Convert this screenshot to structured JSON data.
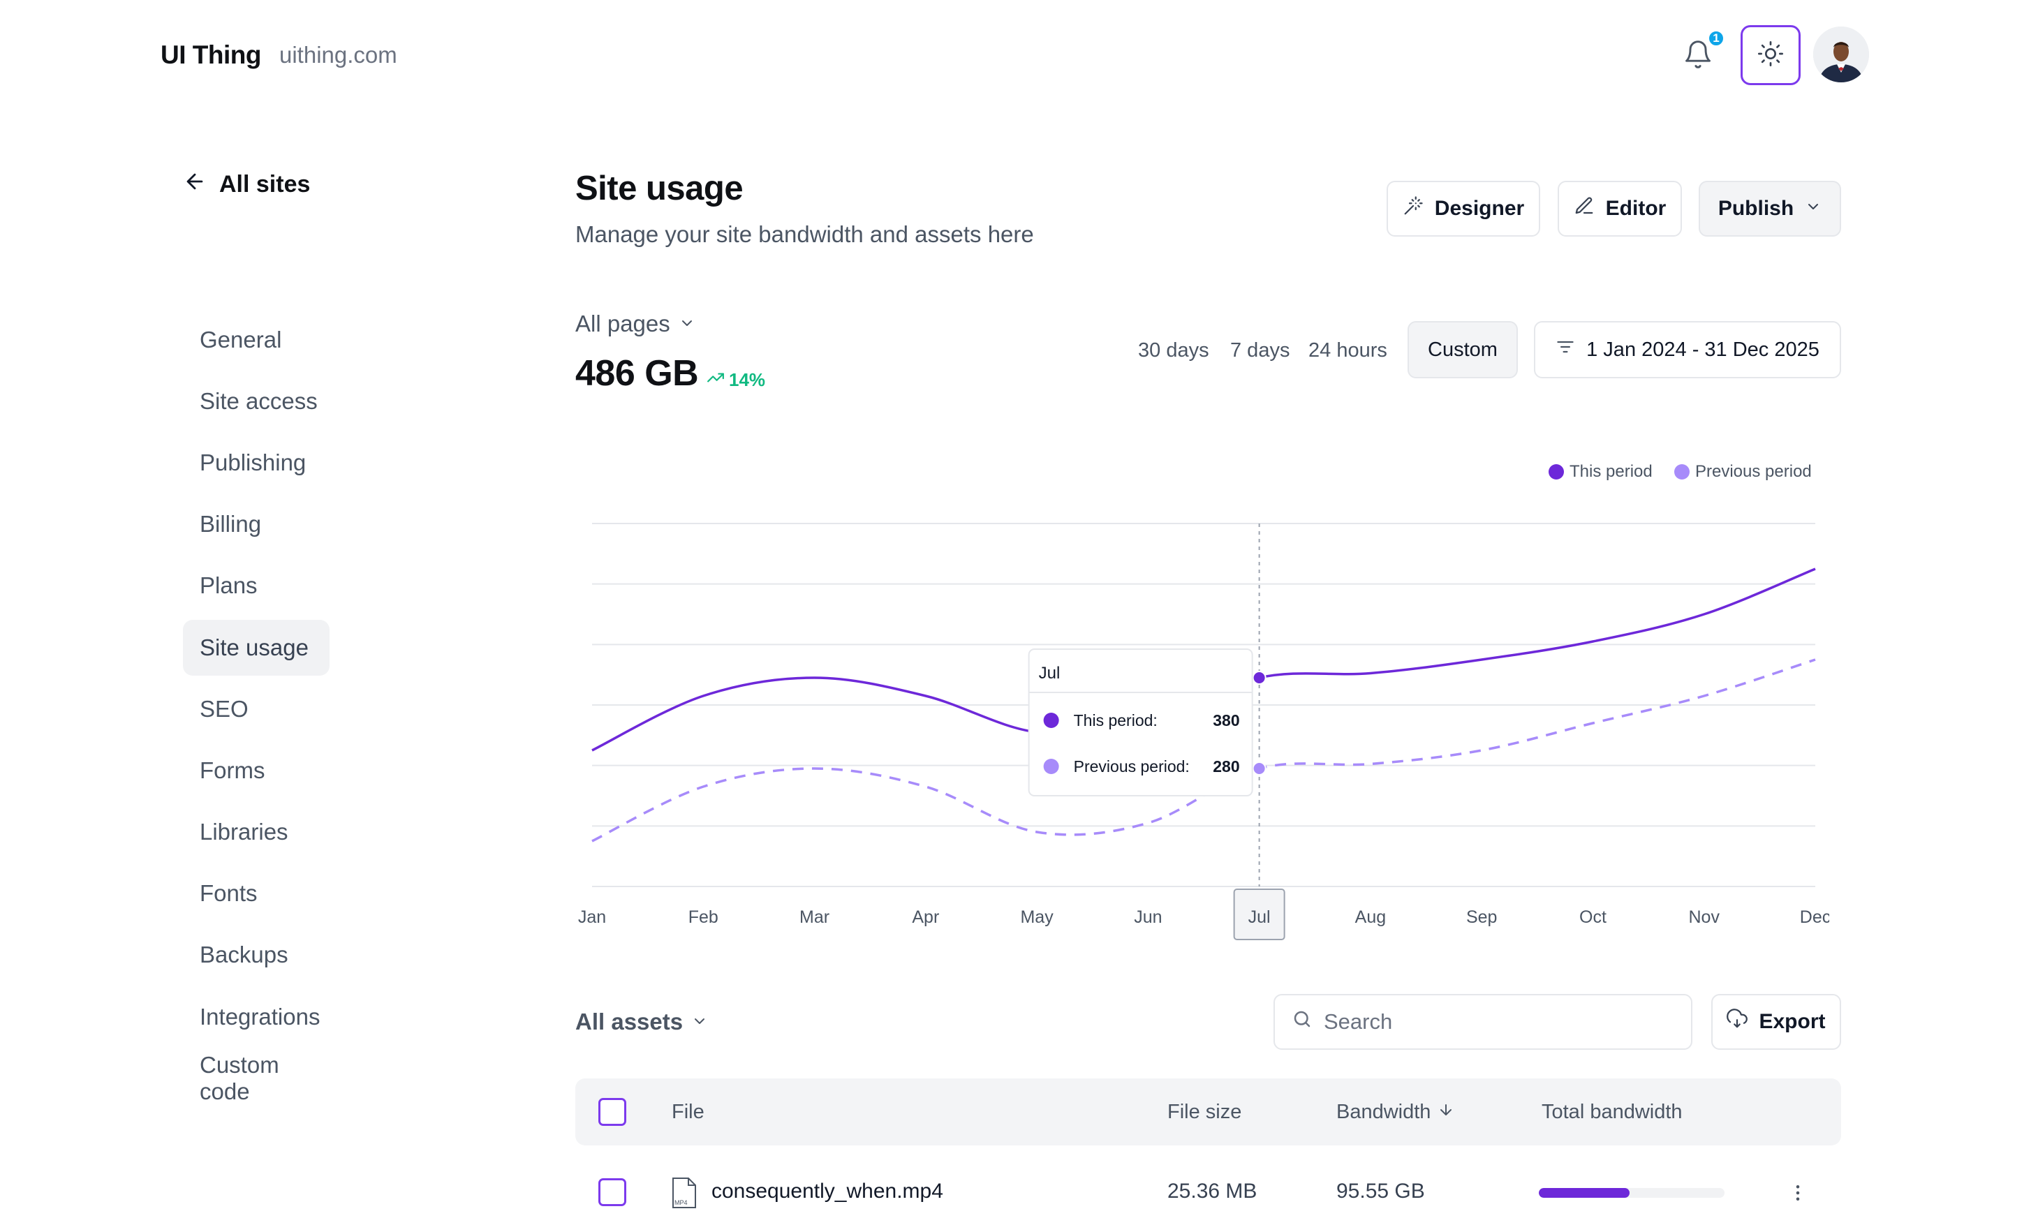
{
  "header": {
    "brand": "UI Thing",
    "domain": "uithing.com",
    "notification_count": "1"
  },
  "sidebar": {
    "back_label": "All sites",
    "items": [
      {
        "label": "General"
      },
      {
        "label": "Site access"
      },
      {
        "label": "Publishing"
      },
      {
        "label": "Billing"
      },
      {
        "label": "Plans"
      },
      {
        "label": "Site usage",
        "active": true
      },
      {
        "label": "SEO"
      },
      {
        "label": "Forms"
      },
      {
        "label": "Libraries"
      },
      {
        "label": "Fonts"
      },
      {
        "label": "Backups"
      },
      {
        "label": "Integrations"
      },
      {
        "label": "Custom code"
      }
    ]
  },
  "page": {
    "title": "Site usage",
    "subtitle": "Manage your site bandwidth and assets here",
    "actions": {
      "designer": "Designer",
      "editor": "Editor",
      "publish": "Publish"
    }
  },
  "usage": {
    "filter": "All pages",
    "total": "486 GB",
    "change": "14%",
    "ranges": [
      "30 days",
      "7 days",
      "24 hours",
      "Custom"
    ],
    "selected_range": "Custom",
    "date_range": "1 Jan 2024 - 31 Dec 2025"
  },
  "chart_data": {
    "type": "line",
    "categories": [
      "Jan",
      "Feb",
      "Mar",
      "Apr",
      "May",
      "Jun",
      "Jul",
      "Aug",
      "Sep",
      "Oct",
      "Nov",
      "Dec"
    ],
    "series": [
      {
        "name": "This period",
        "values": [
          300,
          360,
          380,
          360,
          320,
          330,
          380,
          385,
          400,
          420,
          450,
          500
        ],
        "style": "solid",
        "color": "#6d28d9"
      },
      {
        "name": "Previous period",
        "values": [
          200,
          260,
          280,
          260,
          210,
          220,
          280,
          285,
          300,
          330,
          360,
          400
        ],
        "style": "dashed",
        "color": "#a78bfa"
      }
    ],
    "ylim": [
      150,
      550
    ],
    "grid": true,
    "legend": "top-right",
    "tooltip": {
      "label": "Jul",
      "this_label": "This period:",
      "this_value": "380",
      "prev_label": "Previous period:",
      "prev_value": "280"
    }
  },
  "assets": {
    "filter": "All assets",
    "search_placeholder": "Search",
    "export": "Export",
    "columns": {
      "file": "File",
      "size": "File size",
      "bandwidth": "Bandwidth",
      "total": "Total bandwidth"
    },
    "rows": [
      {
        "file": "consequently_when.mp4",
        "size": "25.36 MB",
        "bandwidth": "95.55 GB",
        "total_fraction": 0.49,
        "type": "MP4"
      }
    ]
  },
  "colors": {
    "accent": "#6d28d9",
    "accent_light": "#a78bfa",
    "positive": "#10b981"
  }
}
